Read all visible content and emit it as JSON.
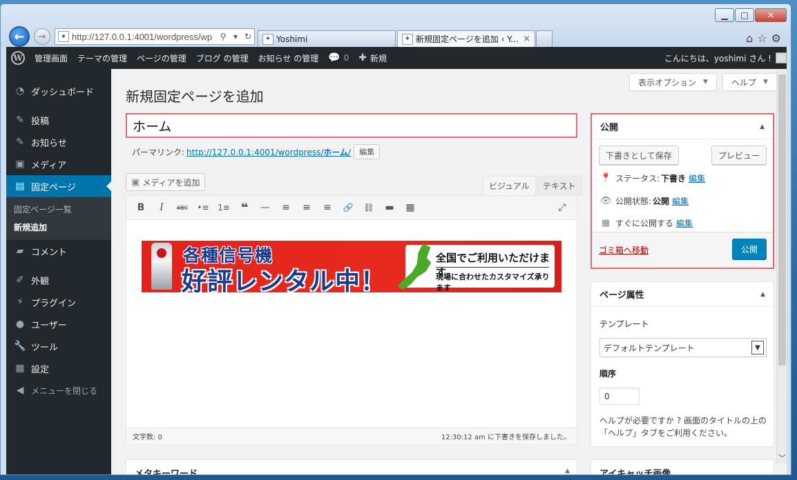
{
  "browser": {
    "address": "http://127.0.0.1:4001/wordpress/wp",
    "tabs": [
      {
        "label": "Yoshimi"
      },
      {
        "label": "新規固定ページを追加 ‹ Y..."
      }
    ],
    "tab_close": "×"
  },
  "adminbar": {
    "logo": "W",
    "items": [
      "管理画面",
      "テーマの管理",
      "ページの管理",
      "ブログ の管理",
      "お知らせ の管理"
    ],
    "comments_count": "0",
    "new_label": "新規",
    "greeting": "こんにちは、yoshimi さん !"
  },
  "sidebar": {
    "items": [
      {
        "label": "ダッシュボード",
        "icon": "dashboard-icon"
      },
      {
        "label": "投稿",
        "icon": "pin-icon"
      },
      {
        "label": "お知らせ",
        "icon": "pin-icon"
      },
      {
        "label": "メディア",
        "icon": "media-icon"
      },
      {
        "label": "固定ページ",
        "icon": "page-icon"
      },
      {
        "label": "コメント",
        "icon": "comment-icon"
      },
      {
        "label": "外観",
        "icon": "brush-icon"
      },
      {
        "label": "プラグイン",
        "icon": "plug-icon"
      },
      {
        "label": "ユーザー",
        "icon": "user-icon"
      },
      {
        "label": "ツール",
        "icon": "wrench-icon"
      },
      {
        "label": "設定",
        "icon": "settings-icon"
      }
    ],
    "submenu": [
      "固定ページ一覧",
      "新規追加"
    ],
    "collapse_label": "メニューを閉じる"
  },
  "screen_options": "表示オプション",
  "help": "ヘルプ",
  "page_title": "新規固定ページを追加",
  "post_title": "ホーム",
  "permalink": {
    "label": "パーマリンク:",
    "url_base": "http://127.0.0.1:4001/wordpress/",
    "slug": "ホーム",
    "url_end": "/",
    "edit_button": "編集"
  },
  "editor": {
    "add_media": "メディアを追加",
    "tab_visual": "ビジュアル",
    "tab_text": "テキスト",
    "toolbar": [
      "B",
      "I",
      "ABC",
      "•≡",
      "1≡",
      "❝",
      "—",
      "≡",
      "≡",
      "≡",
      "🔗",
      "⛓",
      "▬",
      "▦"
    ],
    "banner": {
      "line1": "各種信号機",
      "line2": "好評レンタル中！",
      "box_title": "全国でご利用いただけます",
      "box_sub": "現場に合わせたカスタマイズ承ります"
    },
    "word_count": "文字数: 0",
    "autosave": "12:30:12 am に下書きを保存しました。"
  },
  "meta_box_bottom": "メタキーワード",
  "publish_box": {
    "title": "公開",
    "save_draft": "下書きとして保存",
    "preview": "プレビュー",
    "status_label": "ステータス:",
    "status_value": "下書き",
    "visibility_label": "公開状態:",
    "visibility_value": "公開",
    "schedule_label": "すぐに公開する",
    "edit_link": "編集",
    "trash": "ゴミ箱へ移動",
    "publish_button": "公開"
  },
  "page_attributes": {
    "title": "ページ属性",
    "template_label": "テンプレート",
    "template_value": "デフォルトテンプレート",
    "order_label": "順序",
    "order_value": "0",
    "help_text": "ヘルプが必要ですか ? 画面のタイトルの上の「ヘルプ」タブをご利用ください。"
  },
  "featured_image_title": "アイキャッチ画像",
  "colors": {
    "admin_dark": "#23282d",
    "accent_blue": "#0073aa",
    "highlight_red": "#e8676b"
  }
}
